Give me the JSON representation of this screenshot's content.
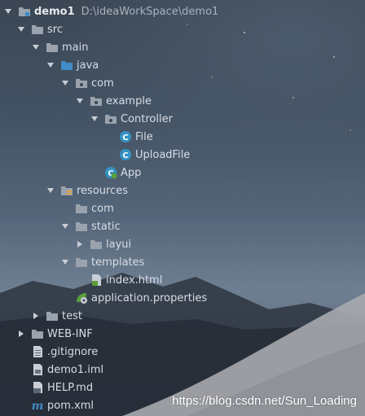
{
  "project": {
    "name": "demo1",
    "path": "D:\\ideaWorkSpace\\demo1"
  },
  "tree": {
    "src": "src",
    "main": "main",
    "java": "java",
    "com": "com",
    "example": "example",
    "controller": "Controller",
    "file": "File",
    "upload_file": "UploadFile",
    "app": "App",
    "resources": "resources",
    "res_com": "com",
    "static": "static",
    "layui": "layui",
    "templates": "templates",
    "index_html": "index.html",
    "application_properties": "application.properties",
    "test": "test",
    "web_inf": "WEB-INF",
    "gitignore": ".gitignore",
    "demo1_iml": "demo1.iml",
    "help_md": "HELP.md",
    "pom_xml": "pom.xml"
  },
  "icons": {
    "folder": "folder-icon",
    "package": "package-icon",
    "source_folder": "source-folder-icon",
    "java_class": "java-class-icon",
    "module": "module-icon"
  },
  "colors": {
    "folder": "#9aa3ad",
    "source_folder": "#3f8cc6",
    "class_badge": "#3592c4",
    "html_badge": "#5a9f3a"
  },
  "watermark": "https://blog.csdn.net/Sun_Loading"
}
